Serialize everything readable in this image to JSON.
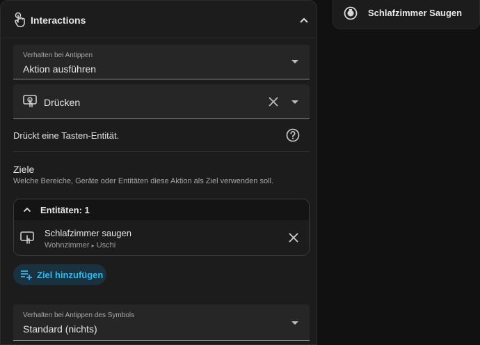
{
  "panel": {
    "title": "Interactions",
    "icons": {
      "header": "touch-hand-icon",
      "collapse": "chevron-up-icon"
    }
  },
  "tap_behavior": {
    "label": "Verhalten bei Antippen",
    "value": "Aktion ausführen"
  },
  "action": {
    "value": "Drücken",
    "icons": {
      "main": "gesture-tap-button-icon",
      "clear": "close-icon",
      "dropdown": "caret-down-icon"
    }
  },
  "action_description": {
    "text": "Drückt eine Tasten-Entität.",
    "icon": "help-circle-icon"
  },
  "targets": {
    "title": "Ziele",
    "subtitle": "Welche Bereiche, Geräte oder Entitäten diese Aktion als Ziel verwenden soll.",
    "entities_header": "Entitäten: 1",
    "entity": {
      "name": "Schlafzimmer saugen",
      "area": "Wohnzimmer",
      "separator": "▸",
      "device": "Uschi"
    },
    "add_button": "Ziel hinzufügen"
  },
  "icon_tap_behavior": {
    "label": "Verhalten bei Antippen des Symbols",
    "value": "Standard (nichts)"
  },
  "preview_card": {
    "label": "Schlafzimmer Saugen",
    "icon": "robot-vacuum-icon"
  },
  "colors": {
    "accent": "#34b8ee",
    "accent_bg": "#1a3140",
    "panel_bg": "#1c1c1c",
    "page_bg": "#111111",
    "field_bg": "#262626"
  }
}
